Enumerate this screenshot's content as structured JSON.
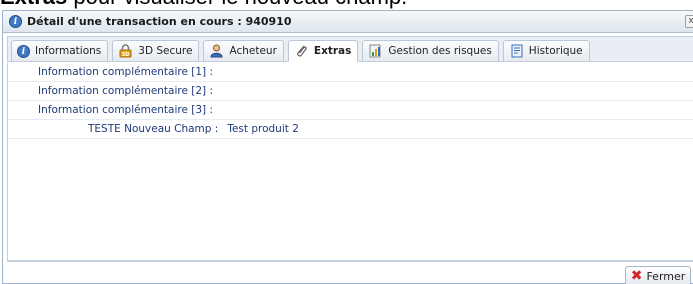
{
  "caption": {
    "bold": "Extras",
    "rest": " pour visualiser le nouveau champ."
  },
  "dialog": {
    "title": "Détail d'une transaction en cours : 940910",
    "close_glyph": "x"
  },
  "tabs": [
    {
      "label": "Informations",
      "icon": "info-icon"
    },
    {
      "label": "3D Secure",
      "icon": "3d-secure-icon"
    },
    {
      "label": "Acheteur",
      "icon": "buyer-icon"
    },
    {
      "label": "Extras",
      "icon": "paperclip-icon",
      "active": true
    },
    {
      "label": "Gestion des risques",
      "icon": "risk-icon"
    },
    {
      "label": "Historique",
      "icon": "history-icon"
    }
  ],
  "rows": [
    {
      "label": "Information complémentaire [1] :",
      "value": ""
    },
    {
      "label": "Information complémentaire [2] :",
      "value": ""
    },
    {
      "label": "Information complémentaire [3] :",
      "value": ""
    },
    {
      "label": "TESTE Nouveau Champ :",
      "value": "Test produit 2"
    }
  ],
  "footer": {
    "close_label": "Fermer"
  }
}
